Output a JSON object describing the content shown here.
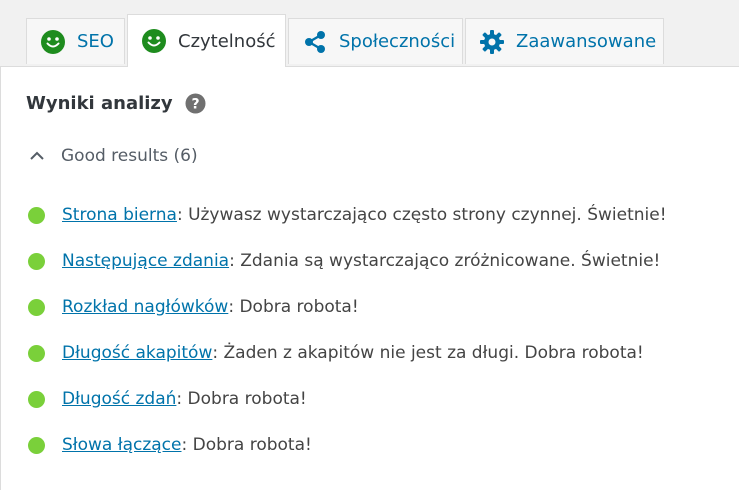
{
  "tabs": [
    {
      "label": "SEO",
      "icon": "smiley-icon",
      "active": false
    },
    {
      "label": "Czytelność",
      "icon": "smiley-icon",
      "active": true
    },
    {
      "label": "Społeczności",
      "icon": "share-icon",
      "active": false
    },
    {
      "label": "Zaawansowane",
      "icon": "gear-icon",
      "active": false
    }
  ],
  "panel": {
    "heading": "Wyniki analizy",
    "help_icon": "question-circle-icon",
    "group_label": "Good results (6)",
    "results": [
      {
        "link": "Strona bierna",
        "text": ": Używasz wystarczająco często strony czynnej. Świetnie!"
      },
      {
        "link": "Następujące zdania",
        "text": ": Zdania są wystarczająco zróżnicowane. Świetnie!"
      },
      {
        "link": "Rozkład nagłówków",
        "text": ": Dobra robota!"
      },
      {
        "link": "Długość akapitów",
        "text": ": Żaden z akapitów nie jest za długi. Dobra robota!"
      },
      {
        "link": "Długość zdań",
        "text": ": Dobra robota!"
      },
      {
        "link": "Słowa łączące",
        "text": ": Dobra robota!"
      }
    ]
  },
  "colors": {
    "good": "#7ad03a",
    "smiley_green": "#1e8c1e",
    "link": "#0073aa"
  }
}
